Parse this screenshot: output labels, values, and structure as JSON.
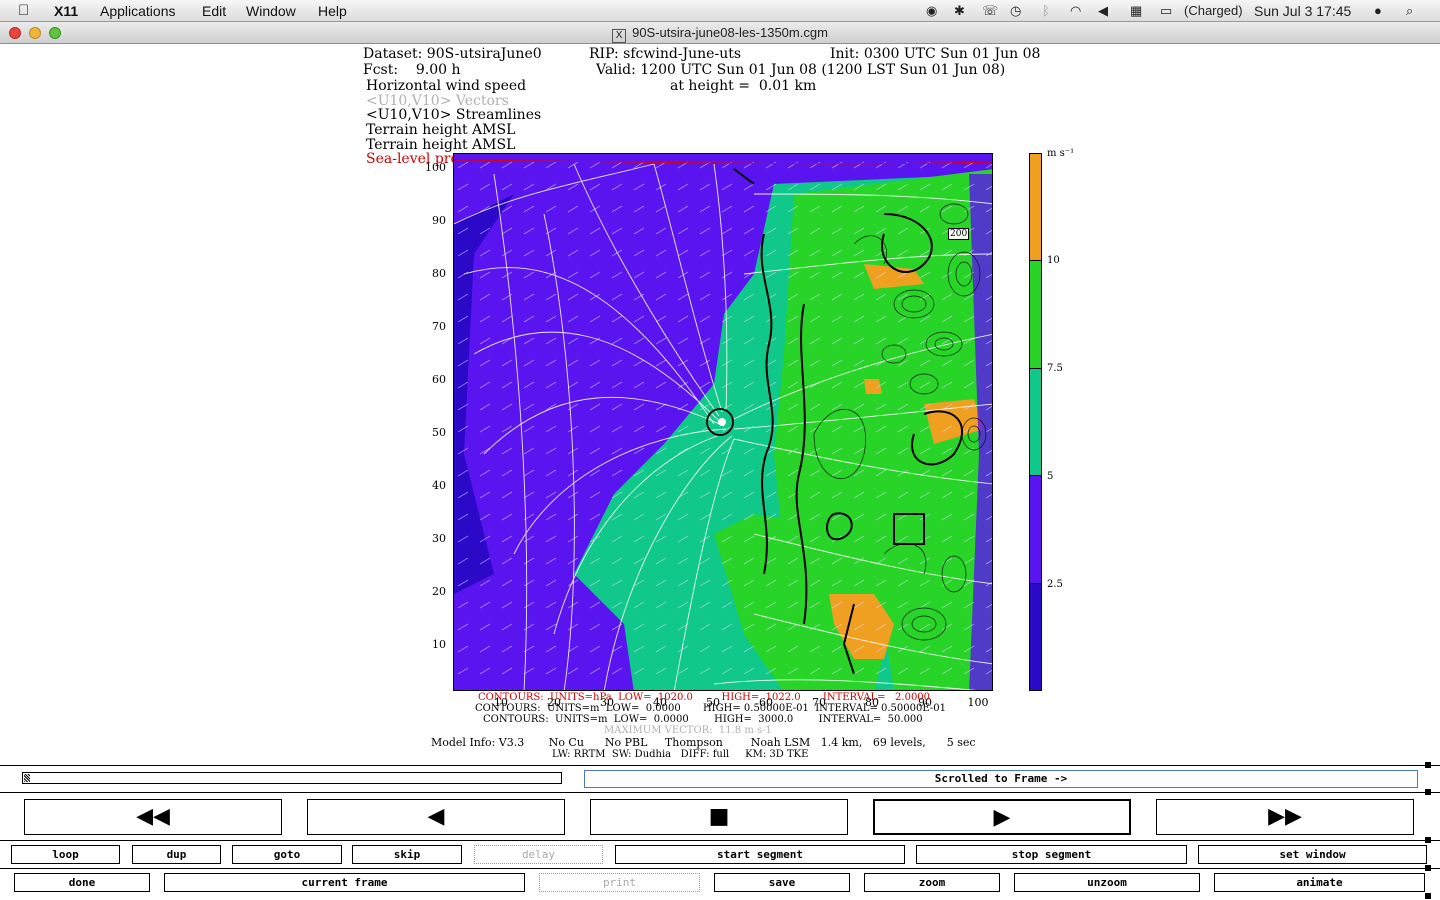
{
  "menubar": {
    "app": "X11",
    "items": [
      "Applications",
      "Edit",
      "Window",
      "Help"
    ],
    "battery": "(Charged)",
    "clock": "Sun Jul 3  17:45"
  },
  "window": {
    "title": "90S-utsira-june08-les-1350m.cgm"
  },
  "header": {
    "dataset": "Dataset: 90S-utsiraJune0",
    "rip": "RIP: sfcwind-June-uts",
    "init": "Init: 0300 UTC Sun 01 Jun 08",
    "fcst": "Fcst:    9.00 h",
    "valid": "Valid: 1200 UTC Sun 01 Jun 08 (1200 LST Sun 01 Jun 08)",
    "height": "at height =  0.01 km",
    "fields": [
      "Horizontal wind speed",
      "<U10,V10> Vectors",
      "<U10,V10> Streamlines",
      "Terrain height AMSL",
      "Terrain height AMSL",
      "Sea-level pressure"
    ]
  },
  "plot": {
    "yticks": [
      "100",
      "90",
      "80",
      "70",
      "60",
      "50",
      "40",
      "30",
      "20",
      "10"
    ],
    "xticks": [
      "10",
      "20",
      "30",
      "40",
      "50",
      "60",
      "70",
      "80",
      "90",
      "100"
    ],
    "contour_label": "200",
    "colorbar": {
      "unit": "m s⁻¹",
      "labels": [
        "10",
        "7.5",
        "5",
        "2.5"
      ],
      "colors": [
        "#f0a020",
        "#28d428",
        "#10c88a",
        "#5a14f0",
        "#2c08c8"
      ]
    }
  },
  "footer": {
    "line1": "CONTOURS:  UNITS=hPa  LOW=  1020.0         HIGH=  1022.0       INTERVAL=   2.0000",
    "line2": "CONTOURS:  UNITS=m  LOW=  0.0000       HIGH= 0.50000E-01  INTERVAL= 0.50000E-01",
    "line3": "CONTOURS:  UNITS=m  LOW=  0.0000        HIGH=  3000.0        INTERVAL=  50.000",
    "line4": "MAXIMUM VECTOR:  11.8 m s-1",
    "model": "Model Info: V3.3       No Cu      No PBL     Thompson        Noah LSM   1.4 km,   69 levels,      5 sec",
    "model2": "LW: RRTM  SW: Dudhia   DIFF: full     KM: 3D TKE"
  },
  "controls": {
    "status": "Scrolled to Frame ->",
    "big": [
      {
        "name": "rewind-button",
        "icon": "fast-rewind-icon",
        "glyph": "◀◀"
      },
      {
        "name": "step-back-button",
        "icon": "step-back-icon",
        "glyph": "◀"
      },
      {
        "name": "stop-button",
        "icon": "stop-icon",
        "glyph": "■"
      },
      {
        "name": "play-button",
        "icon": "play-icon",
        "glyph": "▶"
      },
      {
        "name": "fast-forward-button",
        "icon": "fast-forward-icon",
        "glyph": "▶▶"
      }
    ],
    "row1": [
      "loop",
      "dup",
      "goto",
      "skip",
      "delay",
      "start segment",
      "stop segment",
      "set window"
    ],
    "row2": [
      "done",
      "current frame",
      "print",
      "save",
      "zoom",
      "unzoom",
      "animate"
    ]
  }
}
